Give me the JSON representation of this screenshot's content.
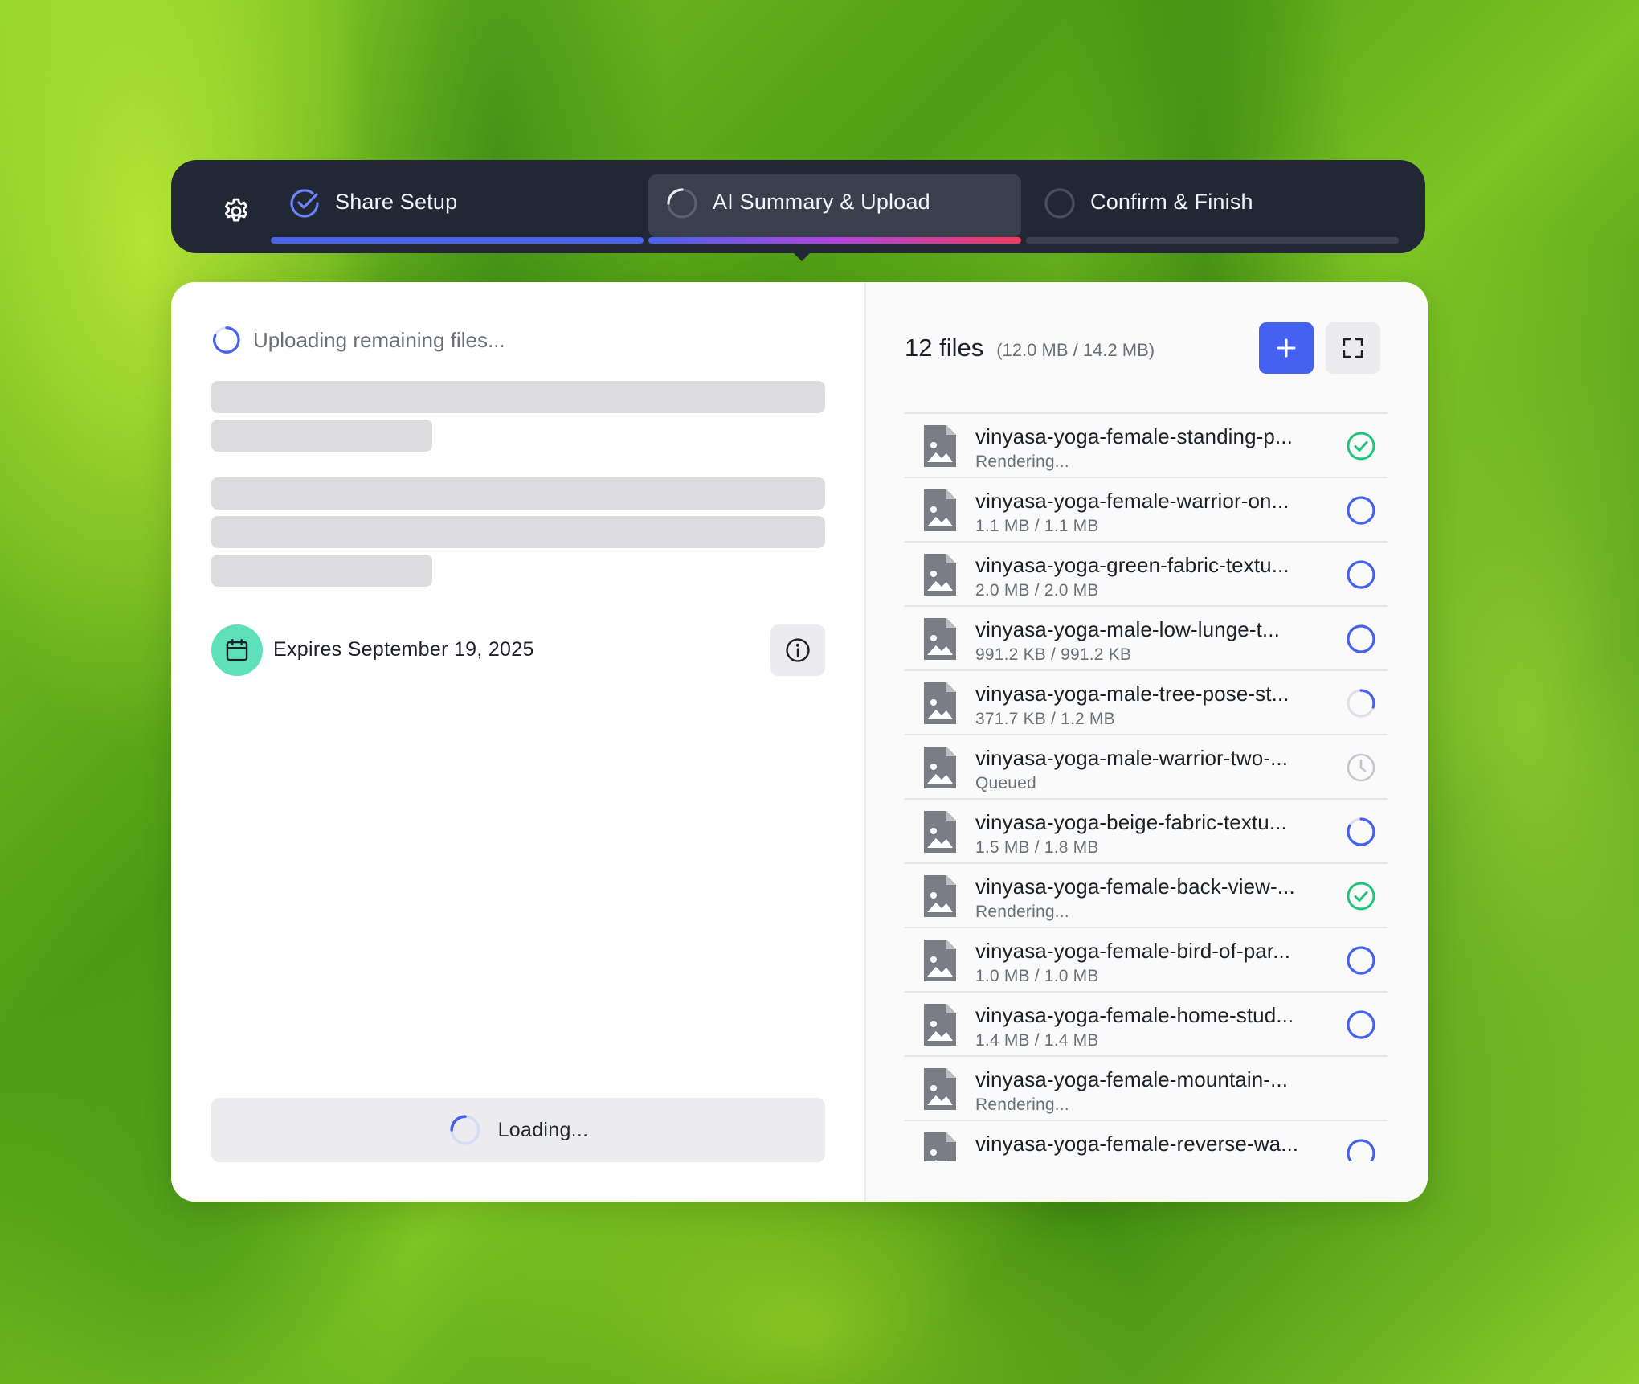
{
  "steps": [
    {
      "label": "Share Setup",
      "state": "complete"
    },
    {
      "label": "AI Summary & Upload",
      "state": "in-progress"
    },
    {
      "label": "Confirm & Finish",
      "state": "pending"
    }
  ],
  "left": {
    "upload_status": "Uploading remaining files...",
    "expires": "Expires September 19, 2025",
    "loading": "Loading..."
  },
  "files": {
    "count_label": "12 files",
    "size_label": "(12.0 MB / 14.2 MB)",
    "items": [
      {
        "name": "vinyasa-yoga-female-standing-p...",
        "meta": "Rendering...",
        "status": "done"
      },
      {
        "name": "vinyasa-yoga-female-warrior-on...",
        "meta": "1.1 MB / 1.1 MB",
        "status": "uploaded"
      },
      {
        "name": "vinyasa-yoga-green-fabric-textu...",
        "meta": "2.0 MB / 2.0 MB",
        "status": "uploaded"
      },
      {
        "name": "vinyasa-yoga-male-low-lunge-t...",
        "meta": "991.2 KB / 991.2 KB",
        "status": "uploaded"
      },
      {
        "name": "vinyasa-yoga-male-tree-pose-st...",
        "meta": "371.7 KB / 1.2 MB",
        "status": "uploading",
        "progress": 0.3
      },
      {
        "name": "vinyasa-yoga-male-warrior-two-...",
        "meta": "Queued",
        "status": "queued"
      },
      {
        "name": "vinyasa-yoga-beige-fabric-textu...",
        "meta": "1.5 MB / 1.8 MB",
        "status": "uploading",
        "progress": 0.83
      },
      {
        "name": "vinyasa-yoga-female-back-view-...",
        "meta": "Rendering...",
        "status": "done"
      },
      {
        "name": "vinyasa-yoga-female-bird-of-par...",
        "meta": "1.0 MB / 1.0 MB",
        "status": "uploaded"
      },
      {
        "name": "vinyasa-yoga-female-home-stud...",
        "meta": "1.4 MB / 1.4 MB",
        "status": "uploaded"
      },
      {
        "name": "vinyasa-yoga-female-mountain-...",
        "meta": "Rendering...",
        "status": "none"
      },
      {
        "name": "vinyasa-yoga-female-reverse-wa...",
        "meta": "",
        "status": "uploaded"
      }
    ]
  },
  "colors": {
    "accent": "#4461f2",
    "success": "#22c27a",
    "dark_bar": "#222736",
    "calendar_badge": "#5fe0b8"
  }
}
